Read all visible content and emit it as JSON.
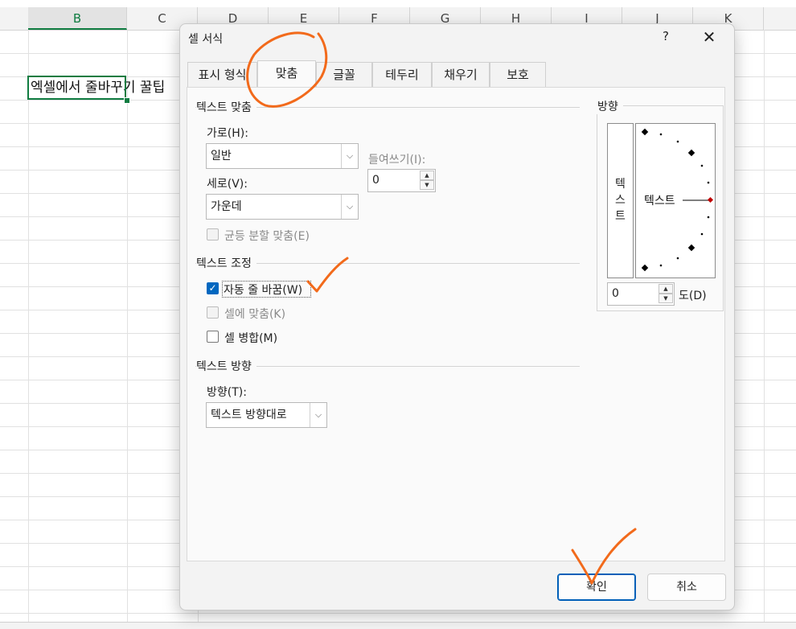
{
  "sheet": {
    "columns": [
      "B",
      "C",
      "D",
      "E",
      "F",
      "G",
      "H",
      "I",
      "J",
      "K"
    ],
    "active_column": "B",
    "cell_text": "엑셀에서 줄바꾸기 꿀팁"
  },
  "dialog": {
    "title": "셀 서식",
    "help_label": "?",
    "close_label": "✕",
    "tabs": [
      "표시 형식",
      "맞춤",
      "글꼴",
      "테두리",
      "채우기",
      "보호"
    ],
    "active_tab": "맞춤",
    "text_align": {
      "section_title": "텍스트 맞춤",
      "horizontal_label": "가로(H):",
      "horizontal_value": "일반",
      "vertical_label": "세로(V):",
      "vertical_value": "가운데",
      "indent_label": "들여쓰기(I):",
      "indent_value": "0",
      "justify_distributed_label": "균등 분할 맞춤(E)"
    },
    "text_control": {
      "section_title": "텍스트 조정",
      "wrap_text_label": "자동 줄 바꿈(W)",
      "wrap_text_checked": true,
      "shrink_to_fit_label": "셀에 맞춤(K)",
      "shrink_to_fit_checked": false,
      "merge_cells_label": "셀 병합(M)",
      "merge_cells_checked": false
    },
    "text_direction": {
      "section_title": "텍스트 방향",
      "direction_label": "방향(T):",
      "direction_value": "텍스트 방향대로"
    },
    "orientation": {
      "section_title": "방향",
      "vertical_text": "텍스트",
      "dial_text": "텍스트",
      "degrees_value": "0",
      "degrees_label": "도(D)"
    },
    "buttons": {
      "ok_label": "확인",
      "cancel_label": "취소"
    }
  },
  "colors": {
    "excel_green": "#107c41",
    "accent_blue": "#0067c0",
    "annotation_orange": "#f26a1b"
  },
  "icons": {
    "checkmark": "checkmark-icon",
    "dropdown": "chevron-down-icon",
    "spin_up": "spin-up-icon",
    "spin_down": "spin-down-icon"
  }
}
